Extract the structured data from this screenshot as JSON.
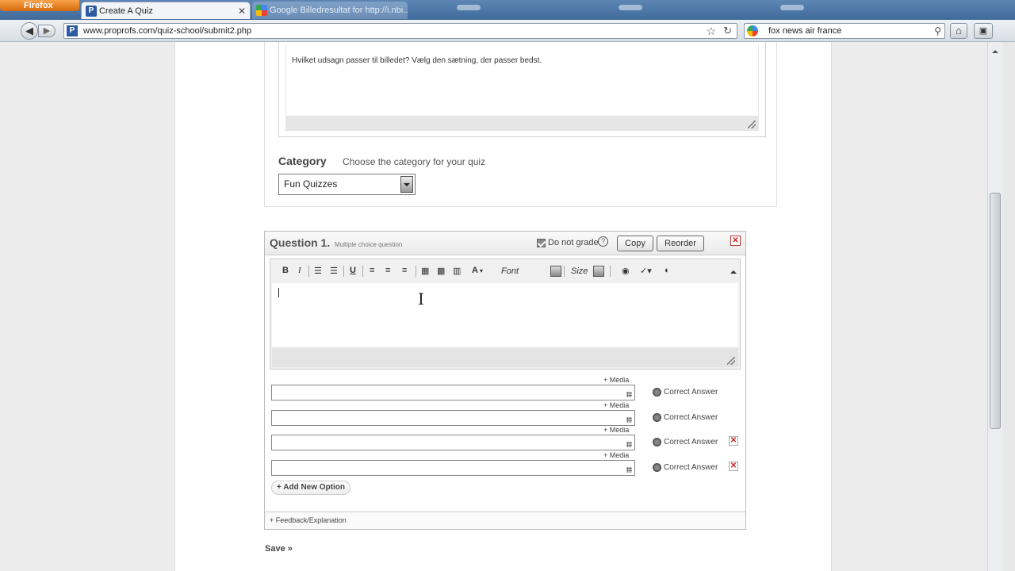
{
  "browser": {
    "app_button": "Firefox",
    "tabs": [
      {
        "title": "Create A Quiz",
        "favicon": "P",
        "active": true
      },
      {
        "title": "Google Billedresultat for http://i.nbi...",
        "favicon": "google-icon",
        "active": false
      }
    ],
    "url": "www.proprofs.com/quiz-school/submit2.php",
    "search_text": "fox news air france"
  },
  "description": {
    "text": "Hvilket udsagn passer til billedet? Vælg den sætning, der passer bedst."
  },
  "category": {
    "label": "Category",
    "hint": "Choose the category for your quiz",
    "selected": "Fun Quizzes"
  },
  "question": {
    "title": "Question 1.",
    "subtitle": "Multiple choice question",
    "do_not_grade_label": "Do not grade",
    "do_not_grade_checked": true,
    "help_symbol": "?",
    "copy_label": "Copy",
    "reorder_label": "Reorder",
    "toolbar": {
      "bold": "B",
      "italic": "I",
      "underline": "U",
      "text_color": "A",
      "font_placeholder": "Font",
      "size_placeholder": "Size"
    },
    "options": [
      {
        "media_label": "+ Media",
        "correct_label": "Correct Answer",
        "deletable": false
      },
      {
        "media_label": "+ Media",
        "correct_label": "Correct Answer",
        "deletable": false
      },
      {
        "media_label": "+ Media",
        "correct_label": "Correct Answer",
        "deletable": true
      },
      {
        "media_label": "+ Media",
        "correct_label": "Correct Answer",
        "deletable": true
      }
    ],
    "add_option_label": "+ Add New Option",
    "feedback_label": "+ Feedback/Explanation"
  },
  "save_label": "Save »",
  "colors": {
    "tabbar": "#4f7aaa",
    "firefox_orange": "#e8821f",
    "delete_red": "#cc2222"
  }
}
